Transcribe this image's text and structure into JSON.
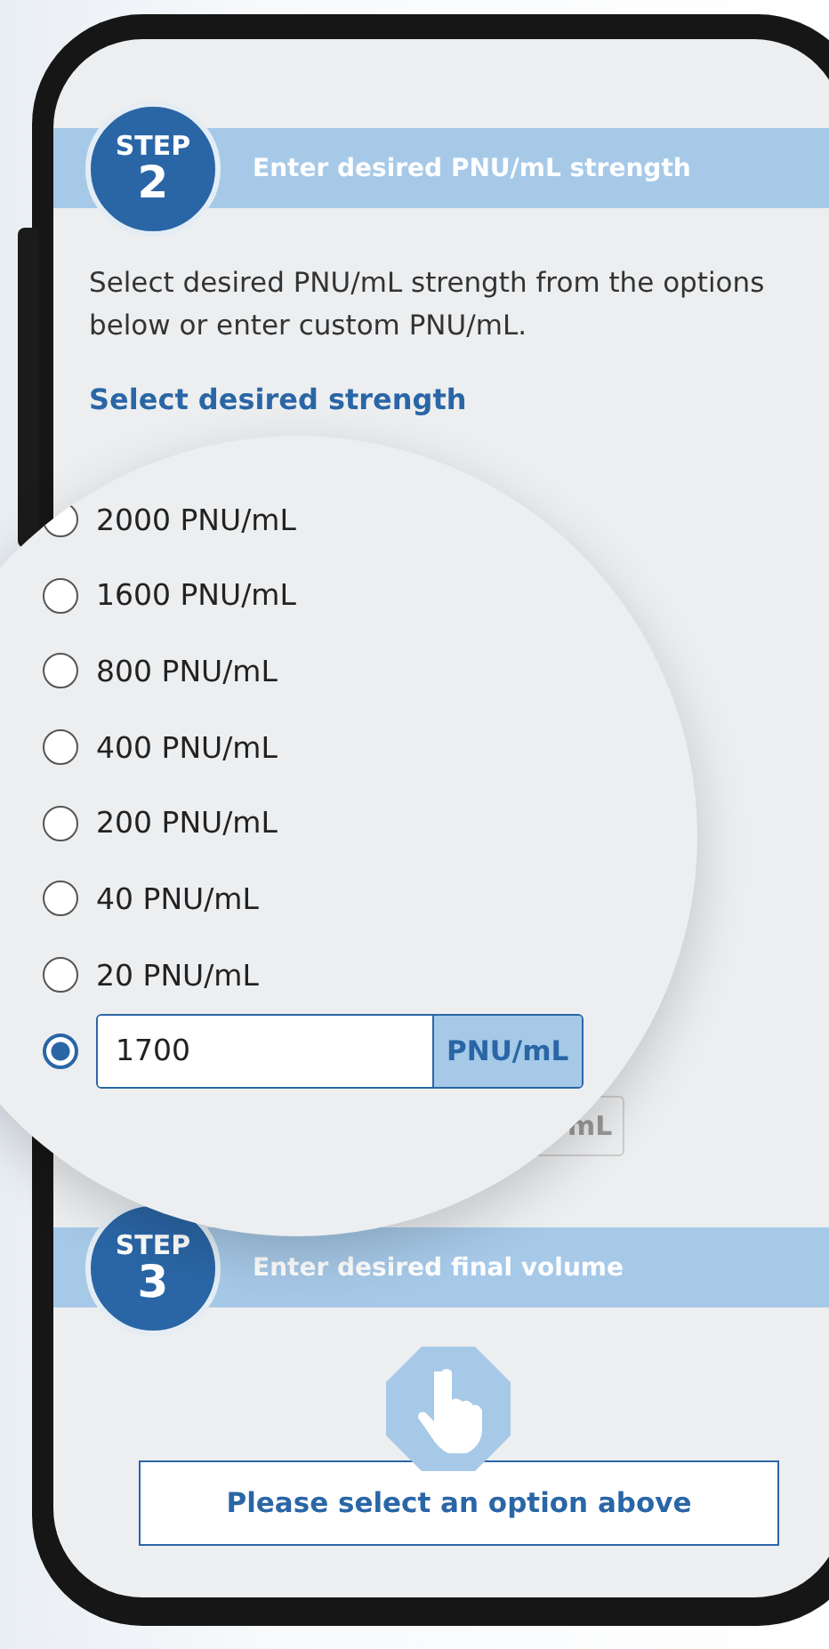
{
  "step2": {
    "badge_label": "STEP",
    "badge_number": "2",
    "title": "Enter desired PNU/mL strength"
  },
  "instructions": "Select desired PNU/mL strength from the options below or enter custom PNU/mL.",
  "section_heading": "Select desired strength",
  "options": [
    {
      "label": "2000 PNU/mL",
      "selected": false
    },
    {
      "label": "1600 PNU/mL",
      "selected": false
    },
    {
      "label": "800 PNU/mL",
      "selected": false
    },
    {
      "label": "400 PNU/mL",
      "selected": false
    },
    {
      "label": "200 PNU/mL",
      "selected": false
    },
    {
      "label": "40 PNU/mL",
      "selected": false
    },
    {
      "label": "20 PNU/mL",
      "selected": false
    }
  ],
  "custom_option": {
    "selected": true,
    "value": "1700",
    "unit": "PNU/mL"
  },
  "covered_unit_fragment": "mL",
  "step3": {
    "badge_label": "STEP",
    "badge_number": "3",
    "title": "Enter desired final volume"
  },
  "prompt_button": "Please select an option above"
}
